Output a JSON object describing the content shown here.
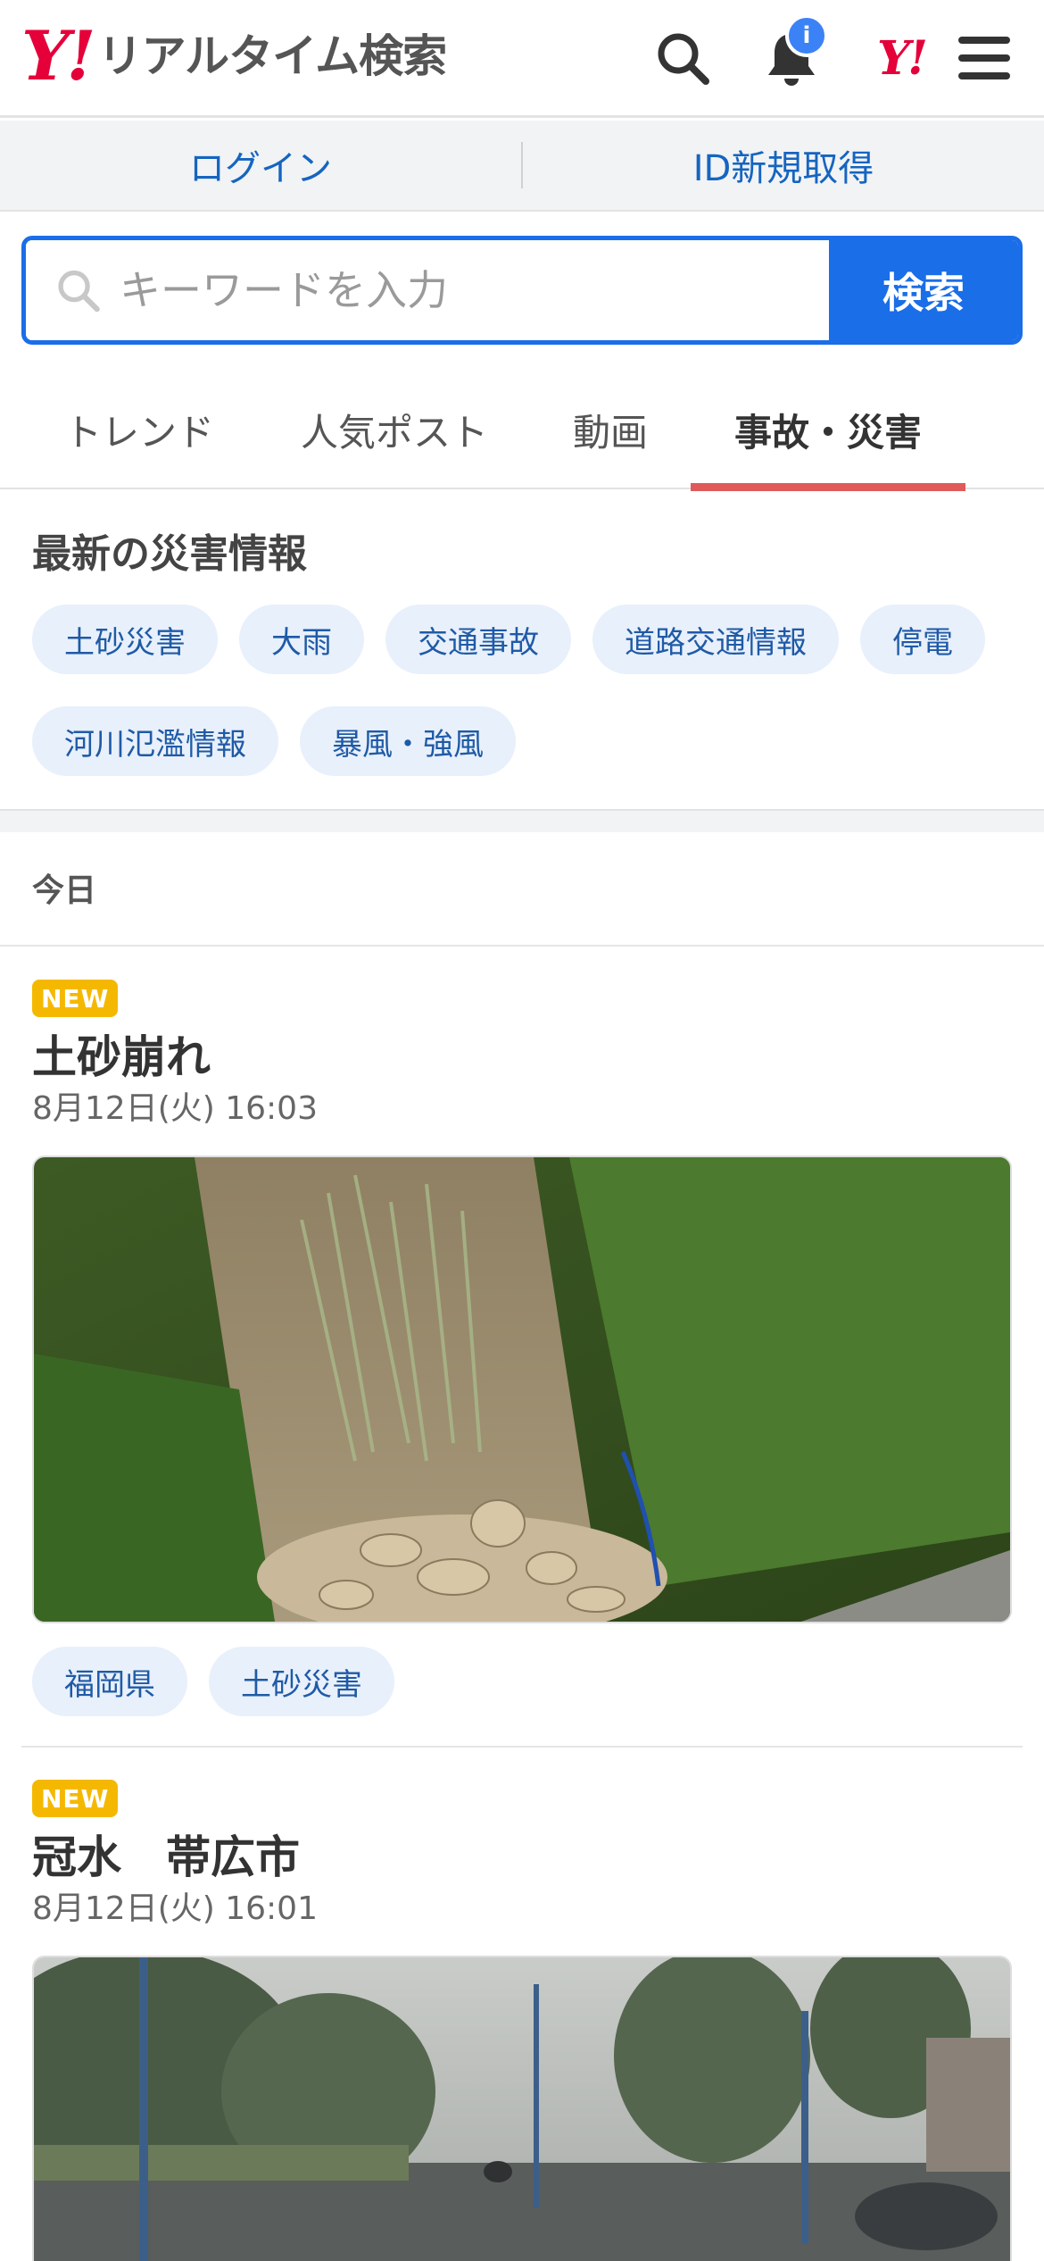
{
  "header": {
    "logo_mark": "Y!",
    "logo_text": "リアルタイム検索",
    "notification_badge": "i",
    "yahoo_icon_text": "Y!"
  },
  "account": {
    "login_label": "ログイン",
    "signup_label": "ID新規取得"
  },
  "search": {
    "placeholder": "キーワードを入力",
    "value": "",
    "button_label": "検索"
  },
  "tabs": [
    {
      "label": "トレンド",
      "active": false
    },
    {
      "label": "人気ポスト",
      "active": false
    },
    {
      "label": "動画",
      "active": false
    },
    {
      "label": "事故・災害",
      "active": true
    }
  ],
  "disaster_info": {
    "title": "最新の災害情報",
    "chips": [
      "土砂災害",
      "大雨",
      "交通事故",
      "道路交通情報",
      "停電",
      "河川氾濫情報",
      "暴風・強風"
    ]
  },
  "feed": {
    "date_heading": "今日",
    "articles": [
      {
        "badge": "NEW",
        "title": "土砂崩れ",
        "time": "8月12日(火) 16:03",
        "tags": [
          "福岡県",
          "土砂災害"
        ]
      },
      {
        "badge": "NEW",
        "title": "冠水　帯広市",
        "time": "8月12日(火) 16:01",
        "tags": []
      }
    ]
  },
  "colors": {
    "accent_blue": "#1a6ee8",
    "link_blue": "#1565c0",
    "brand_red": "#e5003a",
    "tab_underline": "#e05a5a",
    "new_badge": "#f5b800",
    "chip_bg": "#e8f0fb"
  }
}
